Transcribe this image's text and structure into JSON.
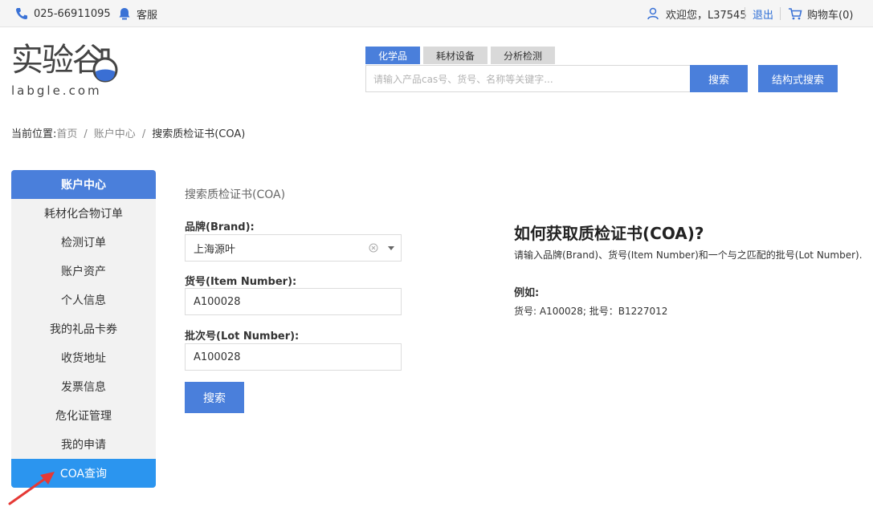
{
  "topbar": {
    "phone": "025-66911095",
    "service": "客服",
    "welcome": "欢迎您，L37545",
    "logout": "退出",
    "cart": "购物车(0)"
  },
  "logo": {
    "chinese": "实验谷",
    "english": "labgle.com"
  },
  "search": {
    "tabs": [
      "化学品",
      "耗材设备",
      "分析检测"
    ],
    "placeholder": "请输入产品cas号、货号、名称等关键字...",
    "search_button": "搜索",
    "structure_button": "结构式搜索"
  },
  "breadcrumb": {
    "prefix": "当前位置:",
    "items": [
      "首页",
      "账户中心",
      "搜索质检证书(COA)"
    ]
  },
  "sidebar": {
    "title": "账户中心",
    "items": [
      "耗材化合物订单",
      "检测订单",
      "账户资产",
      "个人信息",
      "我的礼品卡券",
      "收货地址",
      "发票信息",
      "危化证管理",
      "我的申请",
      "COA查询"
    ],
    "active_index": 9
  },
  "form": {
    "title": "搜索质检证书(COA)",
    "brand_label": "品牌(Brand):",
    "brand_value": "上海源叶",
    "item_label": "货号(Item Number):",
    "item_value": "A100028",
    "lot_label": "批次号(Lot Number):",
    "lot_value": "A100028",
    "submit": "搜索"
  },
  "info": {
    "title": "如何获取质检证书(COA)?",
    "desc": "请输入品牌(Brand)、货号(Item Number)和一个与之匹配的批号(Lot Number).",
    "example_label": "例如:",
    "example": "货号: A100028; 批号：B1227012"
  },
  "colors": {
    "primary": "#4a7fdb",
    "active_item": "#2b95ef",
    "annotation_arrow": "#e53935"
  }
}
